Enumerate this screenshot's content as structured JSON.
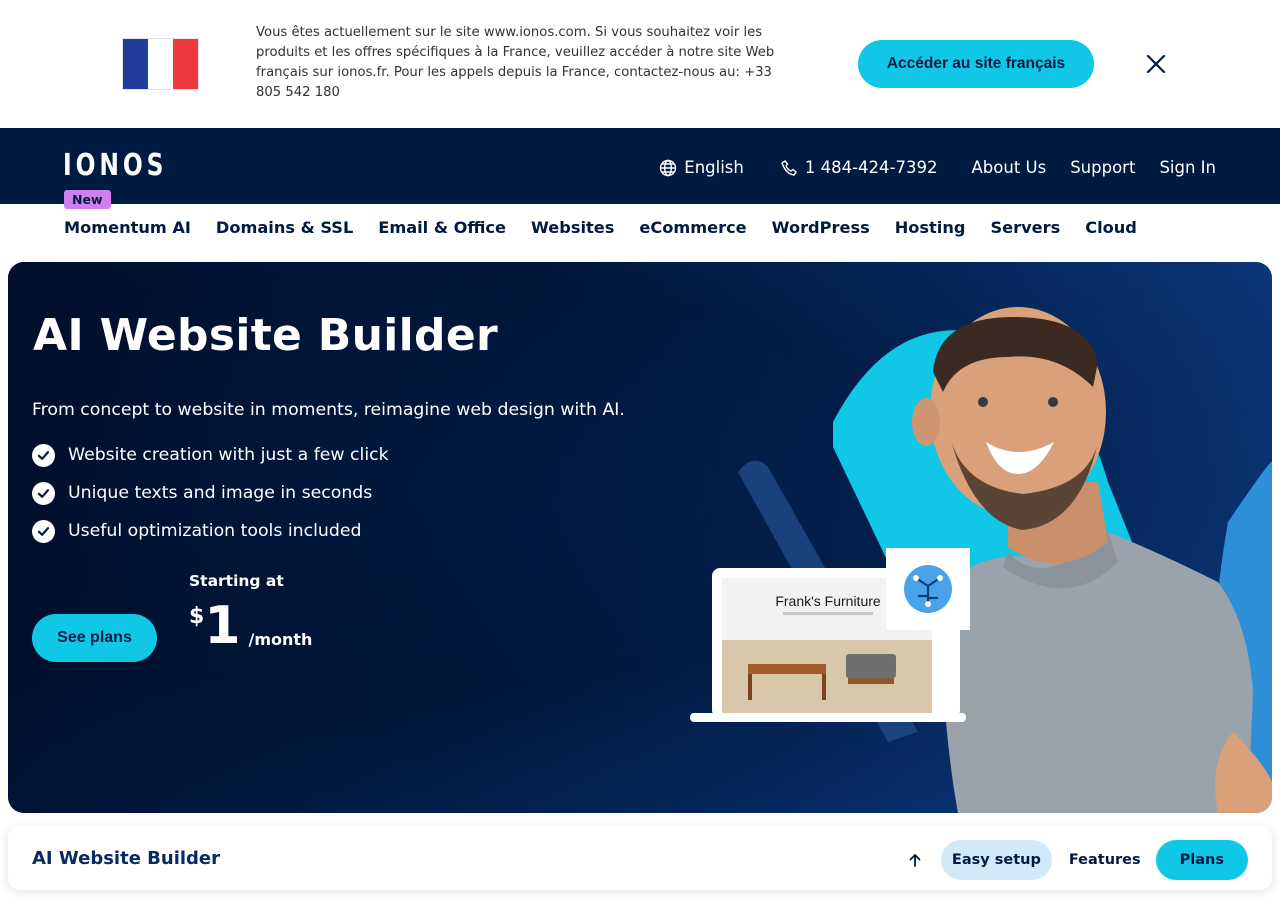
{
  "banner": {
    "message": "Vous êtes actuellement sur le site www.ionos.com. Si vous souhaitez voir les produits et les offres spécifiques à la France, veuillez accéder à notre site Web français sur ionos.fr. Pour les appels depuis la France, contactez-nous au: +33 805 542 180",
    "button_label": "Accéder au site français",
    "close_icon": "close-icon",
    "flag": "france-flag"
  },
  "header": {
    "logo": "IONOS",
    "language": "English",
    "phone": "1 484-424-7392",
    "about": "About Us",
    "support": "Support",
    "signin": "Sign In",
    "badge": "New"
  },
  "nav": {
    "items": [
      "Momentum AI",
      "Domains & SSL",
      "Email & Office",
      "Websites",
      "eCommerce",
      "WordPress",
      "Hosting",
      "Servers",
      "Cloud"
    ]
  },
  "hero": {
    "title": "AI Website Builder",
    "subtitle": "From concept to website in moments, reimagine web design with AI.",
    "bullets": [
      "Website creation with just a few click",
      "Unique texts and image in seconds",
      "Useful optimization tools included"
    ],
    "cta": "See plans",
    "starting_at": "Starting at",
    "currency": "$",
    "price": "1",
    "period": "/month",
    "mockup_title": "Frank's Furniture"
  },
  "subnav": {
    "title": "AI Website Builder",
    "items": [
      "Easy setup",
      "Features",
      "Plans"
    ]
  },
  "colors": {
    "navy": "#001b41",
    "accent": "#11c7e6",
    "badge": "#d07ff0"
  }
}
